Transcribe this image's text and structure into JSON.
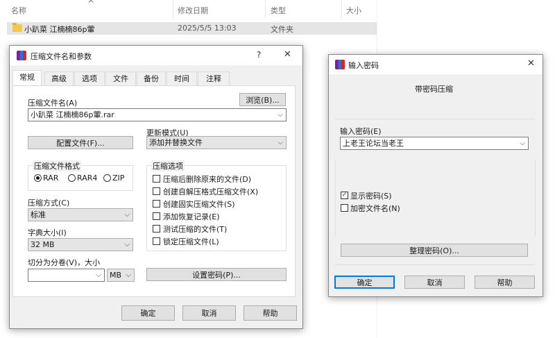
{
  "explorer": {
    "columns": {
      "name": "名称",
      "modified": "修改日期",
      "type": "类型",
      "size": "大小"
    },
    "sort_glyph": "^",
    "row": {
      "name": "小趴菜 江楠楠86p葷",
      "modified": "2025/5/5 13:03",
      "type": "文件夹"
    }
  },
  "archive_dialog": {
    "title": "压缩文件名和参数",
    "help_btn": "?",
    "close_btn": "✕",
    "tabs": [
      "常规",
      "高级",
      "选项",
      "文件",
      "备份",
      "时间",
      "注释"
    ],
    "active_tab": 0,
    "archive_name_label": "压缩文件名(A)",
    "browse_btn": "浏览(B)...",
    "archive_name_value": "小趴菜 江楠楠86p葷.rar",
    "update_mode_label": "更新模式(U)",
    "update_mode_value": "添加并替换文件",
    "profiles_btn": "配置文件(F)...",
    "format_group": "压缩文件格式",
    "formats": [
      "RAR",
      "RAR4",
      "ZIP"
    ],
    "selected_format": "RAR",
    "method_label": "压缩方式(C)",
    "method_value": "标准",
    "dict_label": "字典大小(I)",
    "dict_value": "32 MB",
    "split_label": "切分为分卷(V)，大小",
    "split_value": "",
    "split_unit": "MB",
    "options_group": "压缩选项",
    "options": [
      {
        "label": "压缩后删除原来的文件(D)",
        "checked": false
      },
      {
        "label": "创建自解压格式压缩文件(X)",
        "checked": false
      },
      {
        "label": "创建固实压缩文件(S)",
        "checked": false
      },
      {
        "label": "添加恢复记录(E)",
        "checked": false
      },
      {
        "label": "测试压缩的文件(T)",
        "checked": false
      },
      {
        "label": "锁定压缩文件(L)",
        "checked": false
      }
    ],
    "set_password_btn": "设置密码(P)...",
    "ok_btn": "确定",
    "cancel_btn": "取消",
    "help_footer_btn": "帮助"
  },
  "password_dialog": {
    "title": "输入密码",
    "close_btn": "✕",
    "heading": "带密码压缩",
    "password_label": "输入密码(E)",
    "password_value": "上老王论坛当老王",
    "show_password": {
      "label": "显示密码(S)",
      "checked": true
    },
    "encrypt_names": {
      "label": "加密文件名(N)",
      "checked": false
    },
    "organize_btn": "整理密码(O)...",
    "ok_btn": "确定",
    "cancel_btn": "取消",
    "help_btn": "帮助"
  },
  "icons": {
    "chevron": "⌵",
    "check": "✓",
    "chev_down": "⌄"
  }
}
